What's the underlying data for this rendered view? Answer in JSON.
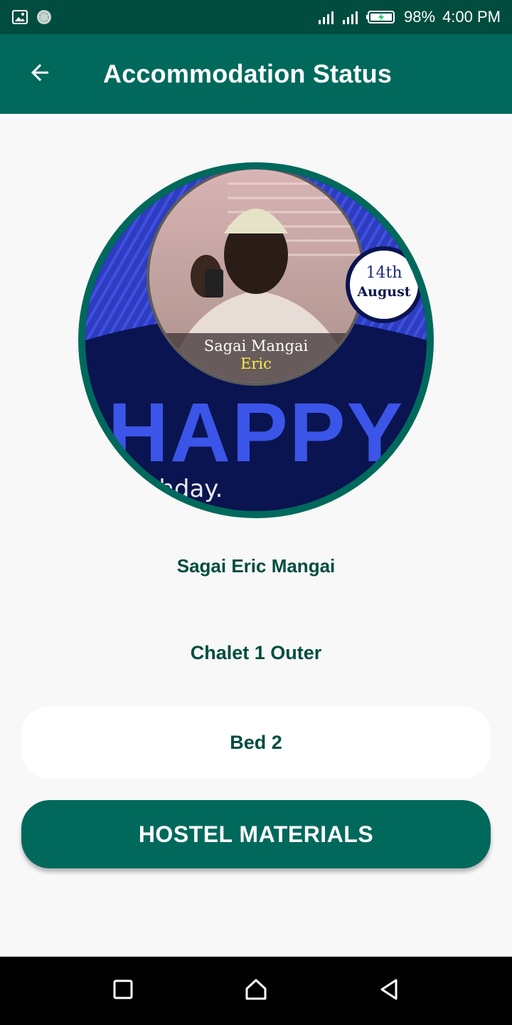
{
  "status_bar": {
    "battery": "98%",
    "time": "4:00 PM",
    "icons": [
      "image-icon",
      "sync-icon",
      "signal-icon",
      "battery-charging-icon"
    ]
  },
  "app_bar": {
    "title": "Accommodation Status",
    "back_icon": "arrow-back-icon"
  },
  "avatar": {
    "caption_name": "Sagai Mangai",
    "caption_highlight": "Eric",
    "date_top": "14th",
    "date_bottom": "August",
    "big_text": "HAPPY",
    "script_text": "thday."
  },
  "user": {
    "name": "Sagai Eric Mangai",
    "room": "Chalet 1 Outer",
    "bed": "Bed 2"
  },
  "actions": {
    "hostel_materials": "HOSTEL MATERIALS"
  },
  "nav": {
    "icons": [
      "recents-square-icon",
      "home-icon",
      "back-triangle-icon"
    ]
  },
  "colors": {
    "primary": "#00695c",
    "primary_dark": "#004d40",
    "background": "#f8f8f8"
  }
}
